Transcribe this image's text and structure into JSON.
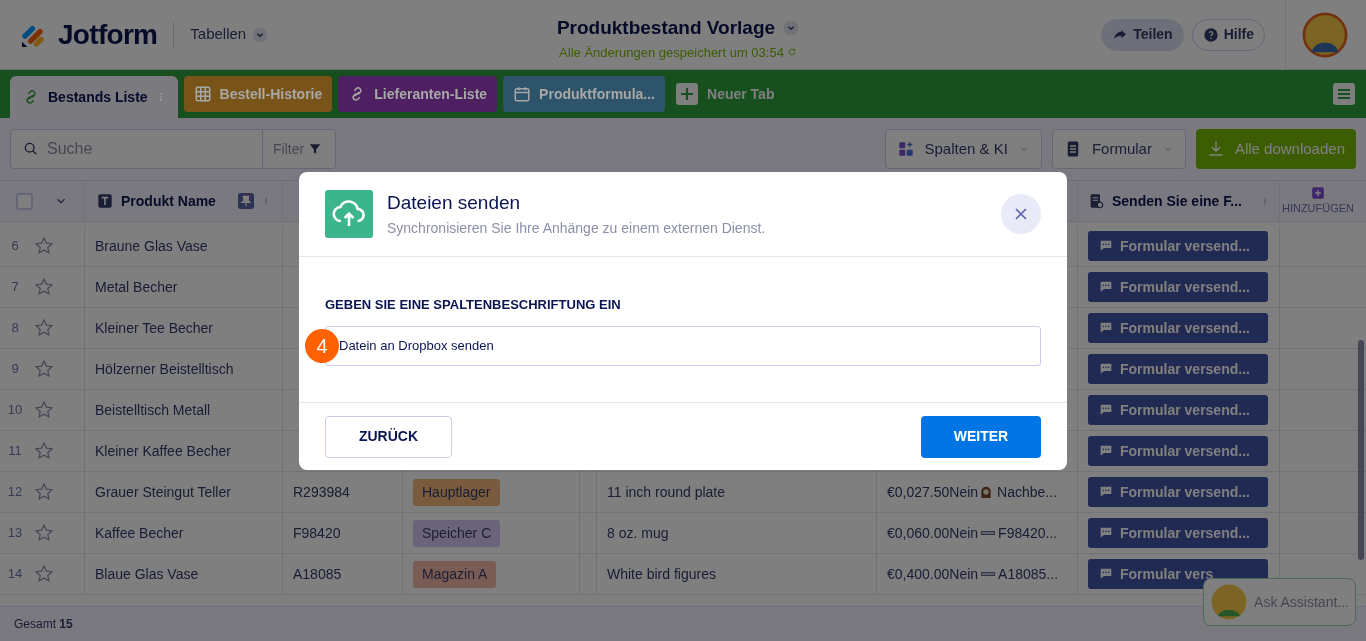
{
  "header": {
    "logo": "Jotform",
    "menu": "Tabellen",
    "title": "Produktbestand Vorlage",
    "save_status": "Alle Änderungen gespeichert um 03:54",
    "buttons": [
      {
        "label": "Teilen",
        "kind": "share"
      },
      {
        "label": "Hilfe",
        "kind": "help"
      }
    ]
  },
  "tabs": [
    {
      "label": "Bestands Liste",
      "selected": true,
      "kind": "link",
      "color": "#7a7a7f"
    },
    {
      "label": "Bestell-Historie",
      "selected": false,
      "kind": "grid",
      "color": "#785418"
    },
    {
      "label": "Lieferanten-Liste",
      "selected": false,
      "kind": "link",
      "color": "#4e2062"
    },
    {
      "label": "Produktformula...",
      "selected": false,
      "kind": "calendar",
      "color": "#2d546b"
    }
  ],
  "new_tab": "Neuer Tab",
  "toolbar": {
    "search_placeholder": "Suche",
    "filter": "Filter",
    "buttons": [
      {
        "label": "Spalten & KI",
        "kind": "columns"
      },
      {
        "label": "Formular",
        "kind": "form"
      },
      {
        "label": "Alle downloaden",
        "kind": "download"
      }
    ]
  },
  "table": {
    "select_all_checked": false,
    "columns": [
      {
        "label": "Produkt Name",
        "kind": "name"
      },
      {
        "label": "Senden Sie eine F...",
        "kind": "action"
      }
    ],
    "add_column": "HINZUFÜGEN",
    "rows": [
      {
        "number": "6",
        "starred": false,
        "name": "Braune Glas Vase",
        "action": "Formular versend..."
      },
      {
        "number": "7",
        "starred": false,
        "name": "Metal Becher",
        "action": "Formular versend..."
      },
      {
        "number": "8",
        "starred": false,
        "name": "Kleiner Tee Becher",
        "action": "Formular versend..."
      },
      {
        "number": "9",
        "starred": false,
        "name": "Hölzerner Beistelltisch",
        "action": "Formular versend..."
      },
      {
        "number": "10",
        "starred": false,
        "name": "Beistelltisch Metall",
        "action": "Formular versend..."
      },
      {
        "number": "11",
        "starred": false,
        "name": "Kleiner Kaffee Becher",
        "action": "Formular versend..."
      },
      {
        "number": "12",
        "starred": false,
        "name": "Grauer Steingut Teller",
        "code": "R293984",
        "tag": {
          "label": "Hauptlager",
          "color": "#7a5b3d"
        },
        "description": "11 inch round plate",
        "price": "€0,027.50",
        "flag": "Nein",
        "extra": {
          "kind": "clock",
          "text": "Nachbe..."
        },
        "action": "Formular versend..."
      },
      {
        "number": "13",
        "starred": false,
        "name": "Kaffee Becher",
        "code": "F98420",
        "tag": {
          "label": "Speicher C",
          "color": "#6b637a"
        },
        "description": "8 oz. mug",
        "price": "€0,060.00",
        "flag": "Nein",
        "extra": {
          "kind": "bar",
          "text": "F98420..."
        },
        "action": "Formular versend..."
      },
      {
        "number": "14",
        "starred": false,
        "name": "Blaue Glas Vase",
        "code": "A18085",
        "tag": {
          "label": "Magazin A",
          "color": "#7b5c54"
        },
        "description": "White bird figures",
        "price": "€0,400.00",
        "flag": "Nein",
        "extra": {
          "kind": "bar",
          "text": "A18085..."
        },
        "action": "Formular vers"
      }
    ]
  },
  "footer": "Gesamt **15**",
  "assistant": "Ask Assistant...",
  "dialog": {
    "title": "Dateien senden",
    "subtitle": "Synchronisieren Sie Ihre Anhänge zu einem externen Dienst.",
    "field_label": "GEBEN SIE EINE SPALTENBESCHRIFTUNG EIN",
    "field_value": "Datein an Dropbox senden",
    "step": "4",
    "back": "ZURÜCK",
    "next": "WEITER"
  }
}
